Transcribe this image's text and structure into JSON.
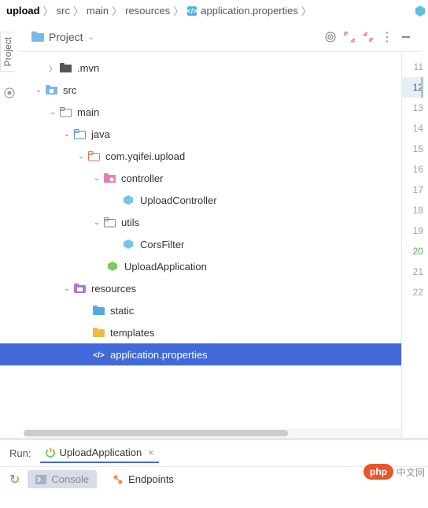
{
  "breadcrumb": {
    "root": "upload",
    "parts": [
      "src",
      "main",
      "resources",
      "application.properties"
    ]
  },
  "toolbar": {
    "project_label": "Project"
  },
  "vtab": {
    "label": "Project"
  },
  "tree": {
    "mvn": ".mvn",
    "src": "src",
    "main": "main",
    "java": "java",
    "pkg": "com.yqifei.upload",
    "controller": "controller",
    "upload_controller": "UploadController",
    "utils": "utils",
    "cors_filter": "CorsFilter",
    "upload_application": "UploadApplication",
    "resources": "resources",
    "static": "static",
    "templates": "templates",
    "app_props": "application.properties"
  },
  "gutter": {
    "lines": [
      "11",
      "12",
      "13",
      "14",
      "15",
      "16",
      "17",
      "18",
      "19",
      "20",
      "21",
      "22"
    ]
  },
  "run": {
    "label": "Run:",
    "tab": "UploadApplication",
    "console": "Console",
    "endpoints": "Endpoints"
  },
  "watermark": {
    "badge": "php",
    "text": "中文网"
  }
}
